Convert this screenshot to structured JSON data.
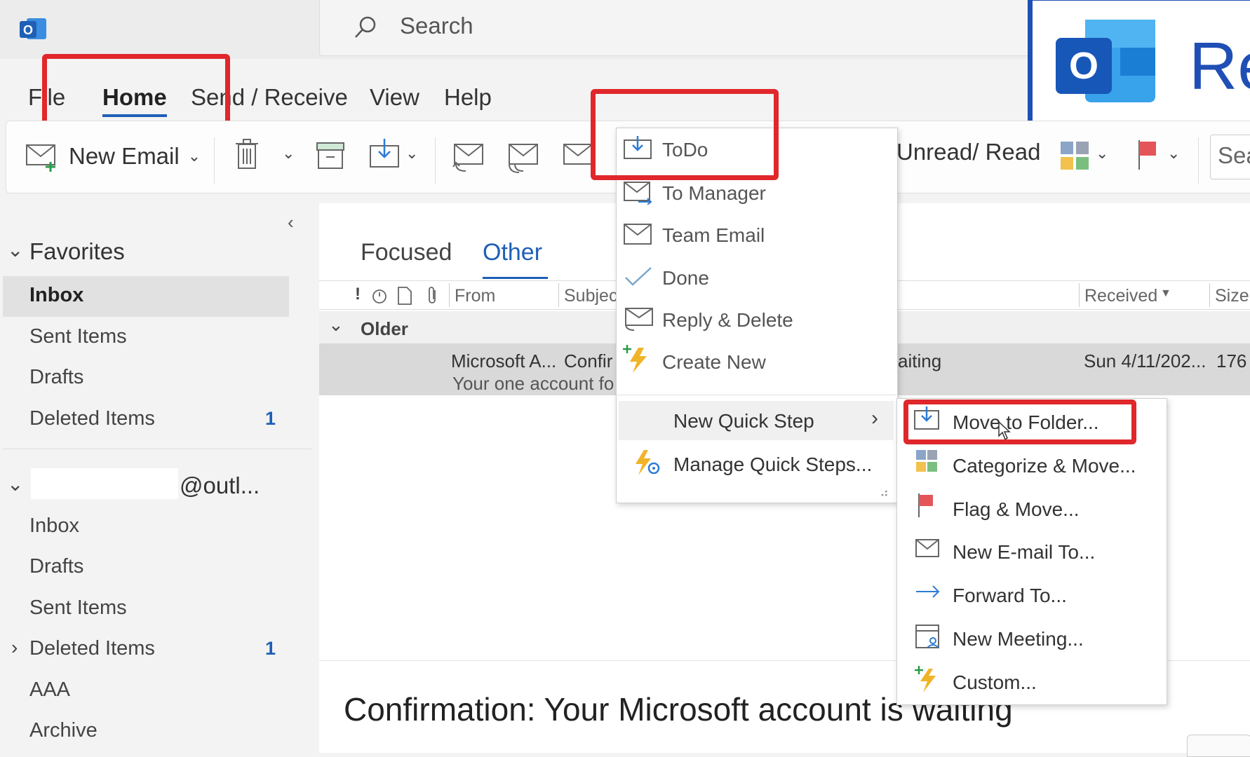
{
  "search": {
    "placeholder": "Search"
  },
  "brand": {
    "letters": "Re"
  },
  "menu": {
    "file": "File",
    "home": "Home",
    "send_receive": "Send / Receive",
    "view": "View",
    "help": "Help"
  },
  "ribbon": {
    "new_email": "New Email",
    "unread_read": "Unread/ Read",
    "search_stub": "Sea"
  },
  "sidebar": {
    "favorites_header": "Favorites",
    "favorites": [
      {
        "label": "Inbox",
        "count": ""
      },
      {
        "label": "Sent Items",
        "count": ""
      },
      {
        "label": "Drafts",
        "count": ""
      },
      {
        "label": "Deleted Items",
        "count": "1"
      }
    ],
    "account_header": "@outl...",
    "account_folders": [
      {
        "label": "Inbox",
        "count": ""
      },
      {
        "label": "Drafts",
        "count": ""
      },
      {
        "label": "Sent Items",
        "count": ""
      },
      {
        "label": "Deleted Items",
        "count": "1"
      },
      {
        "label": "AAA",
        "count": ""
      },
      {
        "label": "Archive",
        "count": ""
      }
    ]
  },
  "mail_tabs": {
    "focused": "Focused",
    "other": "Other"
  },
  "columns": {
    "from": "From",
    "subject": "Subjec",
    "received": "Received",
    "size": "Size"
  },
  "list": {
    "group": "Older",
    "row": {
      "from": "Microsoft A...",
      "subject_prefix": "Confir",
      "subject_suffix": "aiting",
      "preview": "Your one account fo",
      "received": "Sun 4/11/202...",
      "size": "176"
    }
  },
  "reading_title": "Confirmation: Your Microsoft account is waiting",
  "quick_steps": {
    "items": [
      "ToDo",
      "To Manager",
      "Team Email",
      "Done",
      "Reply & Delete",
      "Create New"
    ],
    "new_quick_step": "New Quick Step",
    "manage": "Manage Quick Steps..."
  },
  "submenu": {
    "items": [
      "Move to Folder...",
      "Categorize & Move...",
      "Flag & Move...",
      "New E-mail To...",
      "Forward To...",
      "New Meeting...",
      "Custom..."
    ]
  },
  "colors": {
    "accent": "#1f5fb5",
    "highlight": "#e0272b",
    "outlook_blue": "#1f4fb5"
  }
}
